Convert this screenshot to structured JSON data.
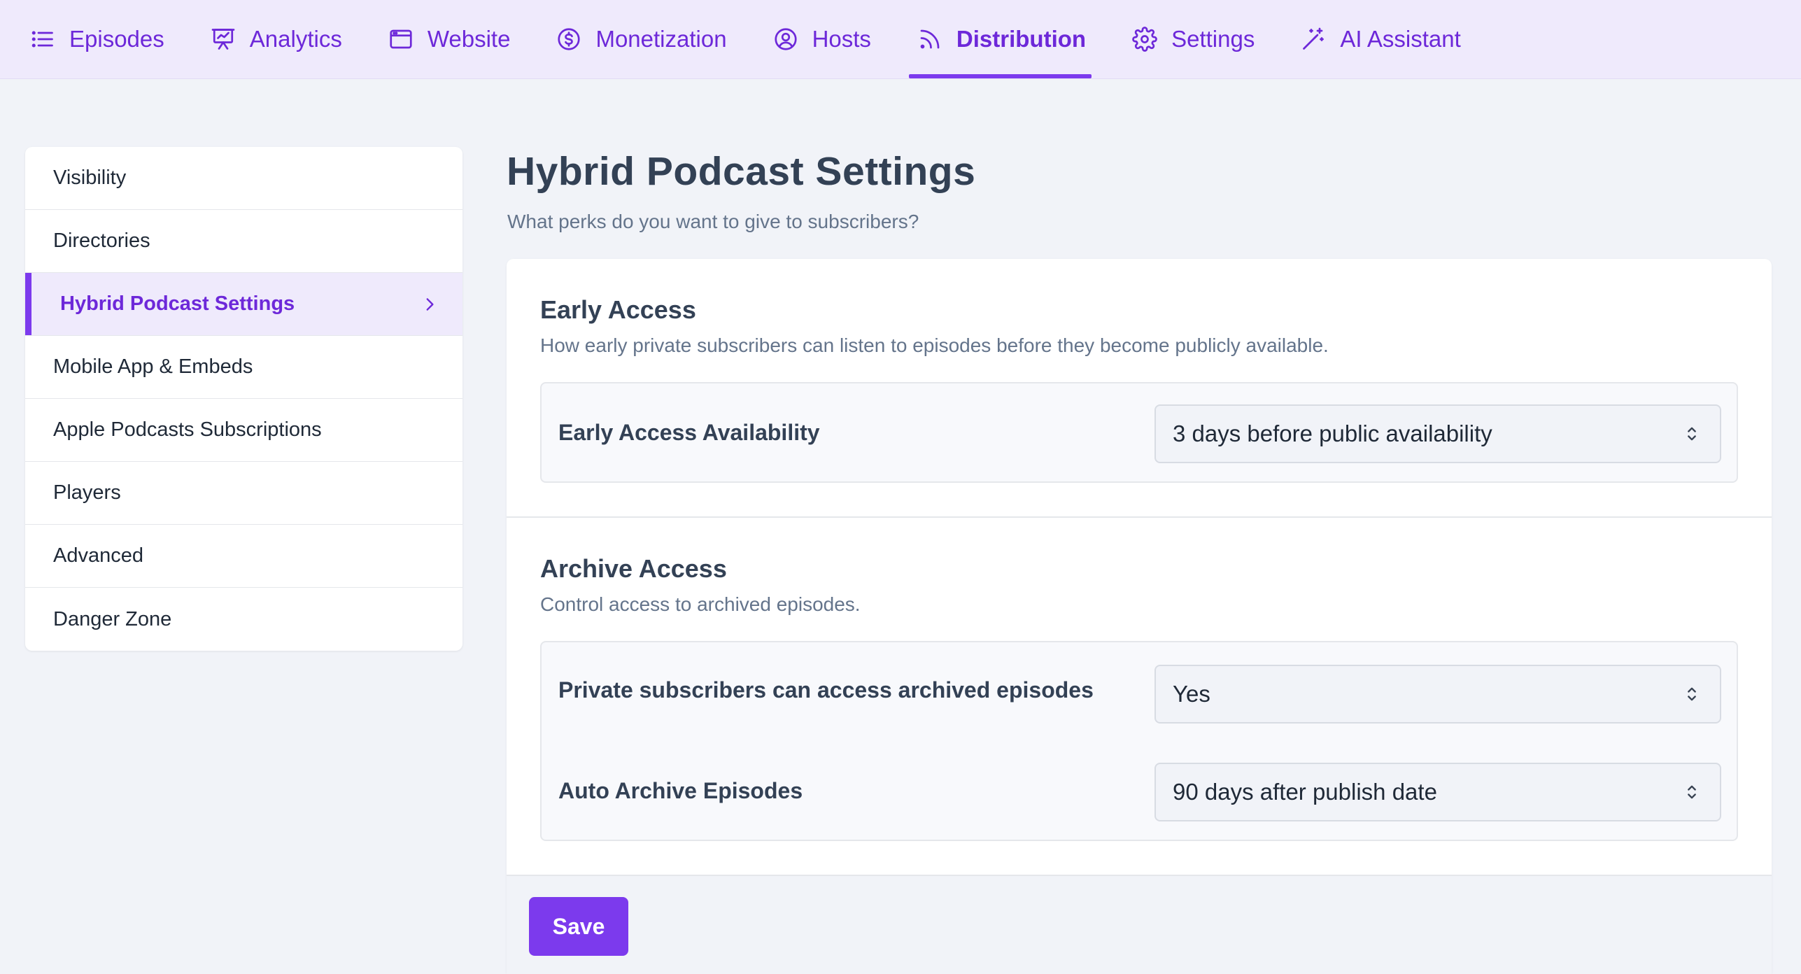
{
  "topnav": {
    "items": [
      {
        "label": "Episodes",
        "icon": "list-icon"
      },
      {
        "label": "Analytics",
        "icon": "presentation-chart-icon"
      },
      {
        "label": "Website",
        "icon": "browser-window-icon"
      },
      {
        "label": "Monetization",
        "icon": "dollar-circle-icon"
      },
      {
        "label": "Hosts",
        "icon": "user-circle-icon"
      },
      {
        "label": "Distribution",
        "icon": "rss-icon"
      },
      {
        "label": "Settings",
        "icon": "gear-icon"
      },
      {
        "label": "AI Assistant",
        "icon": "magic-wand-icon"
      }
    ],
    "active": "Distribution"
  },
  "sidebar": {
    "items": [
      {
        "label": "Visibility"
      },
      {
        "label": "Directories"
      },
      {
        "label": "Hybrid Podcast Settings"
      },
      {
        "label": "Mobile App & Embeds"
      },
      {
        "label": "Apple Podcasts Subscriptions"
      },
      {
        "label": "Players"
      },
      {
        "label": "Advanced"
      },
      {
        "label": "Danger Zone"
      }
    ],
    "active": "Hybrid Podcast Settings"
  },
  "main": {
    "title": "Hybrid Podcast Settings",
    "subtitle": "What perks do you want to give to subscribers?",
    "early_access": {
      "title": "Early Access",
      "description": "How early private subscribers can listen to episodes before they become publicly available.",
      "availability_label": "Early Access Availability",
      "availability_value": "3 days before public availability"
    },
    "archive_access": {
      "title": "Archive Access",
      "description": "Control access to archived episodes.",
      "private_label": "Private subscribers can access archived episodes",
      "private_value": "Yes",
      "auto_archive_label": "Auto Archive Episodes",
      "auto_archive_value": "90 days after publish date"
    },
    "save_label": "Save"
  },
  "colors": {
    "accent": "#7c3aed",
    "nav_bg": "#efeafc",
    "page_bg": "#f1f3f8"
  }
}
